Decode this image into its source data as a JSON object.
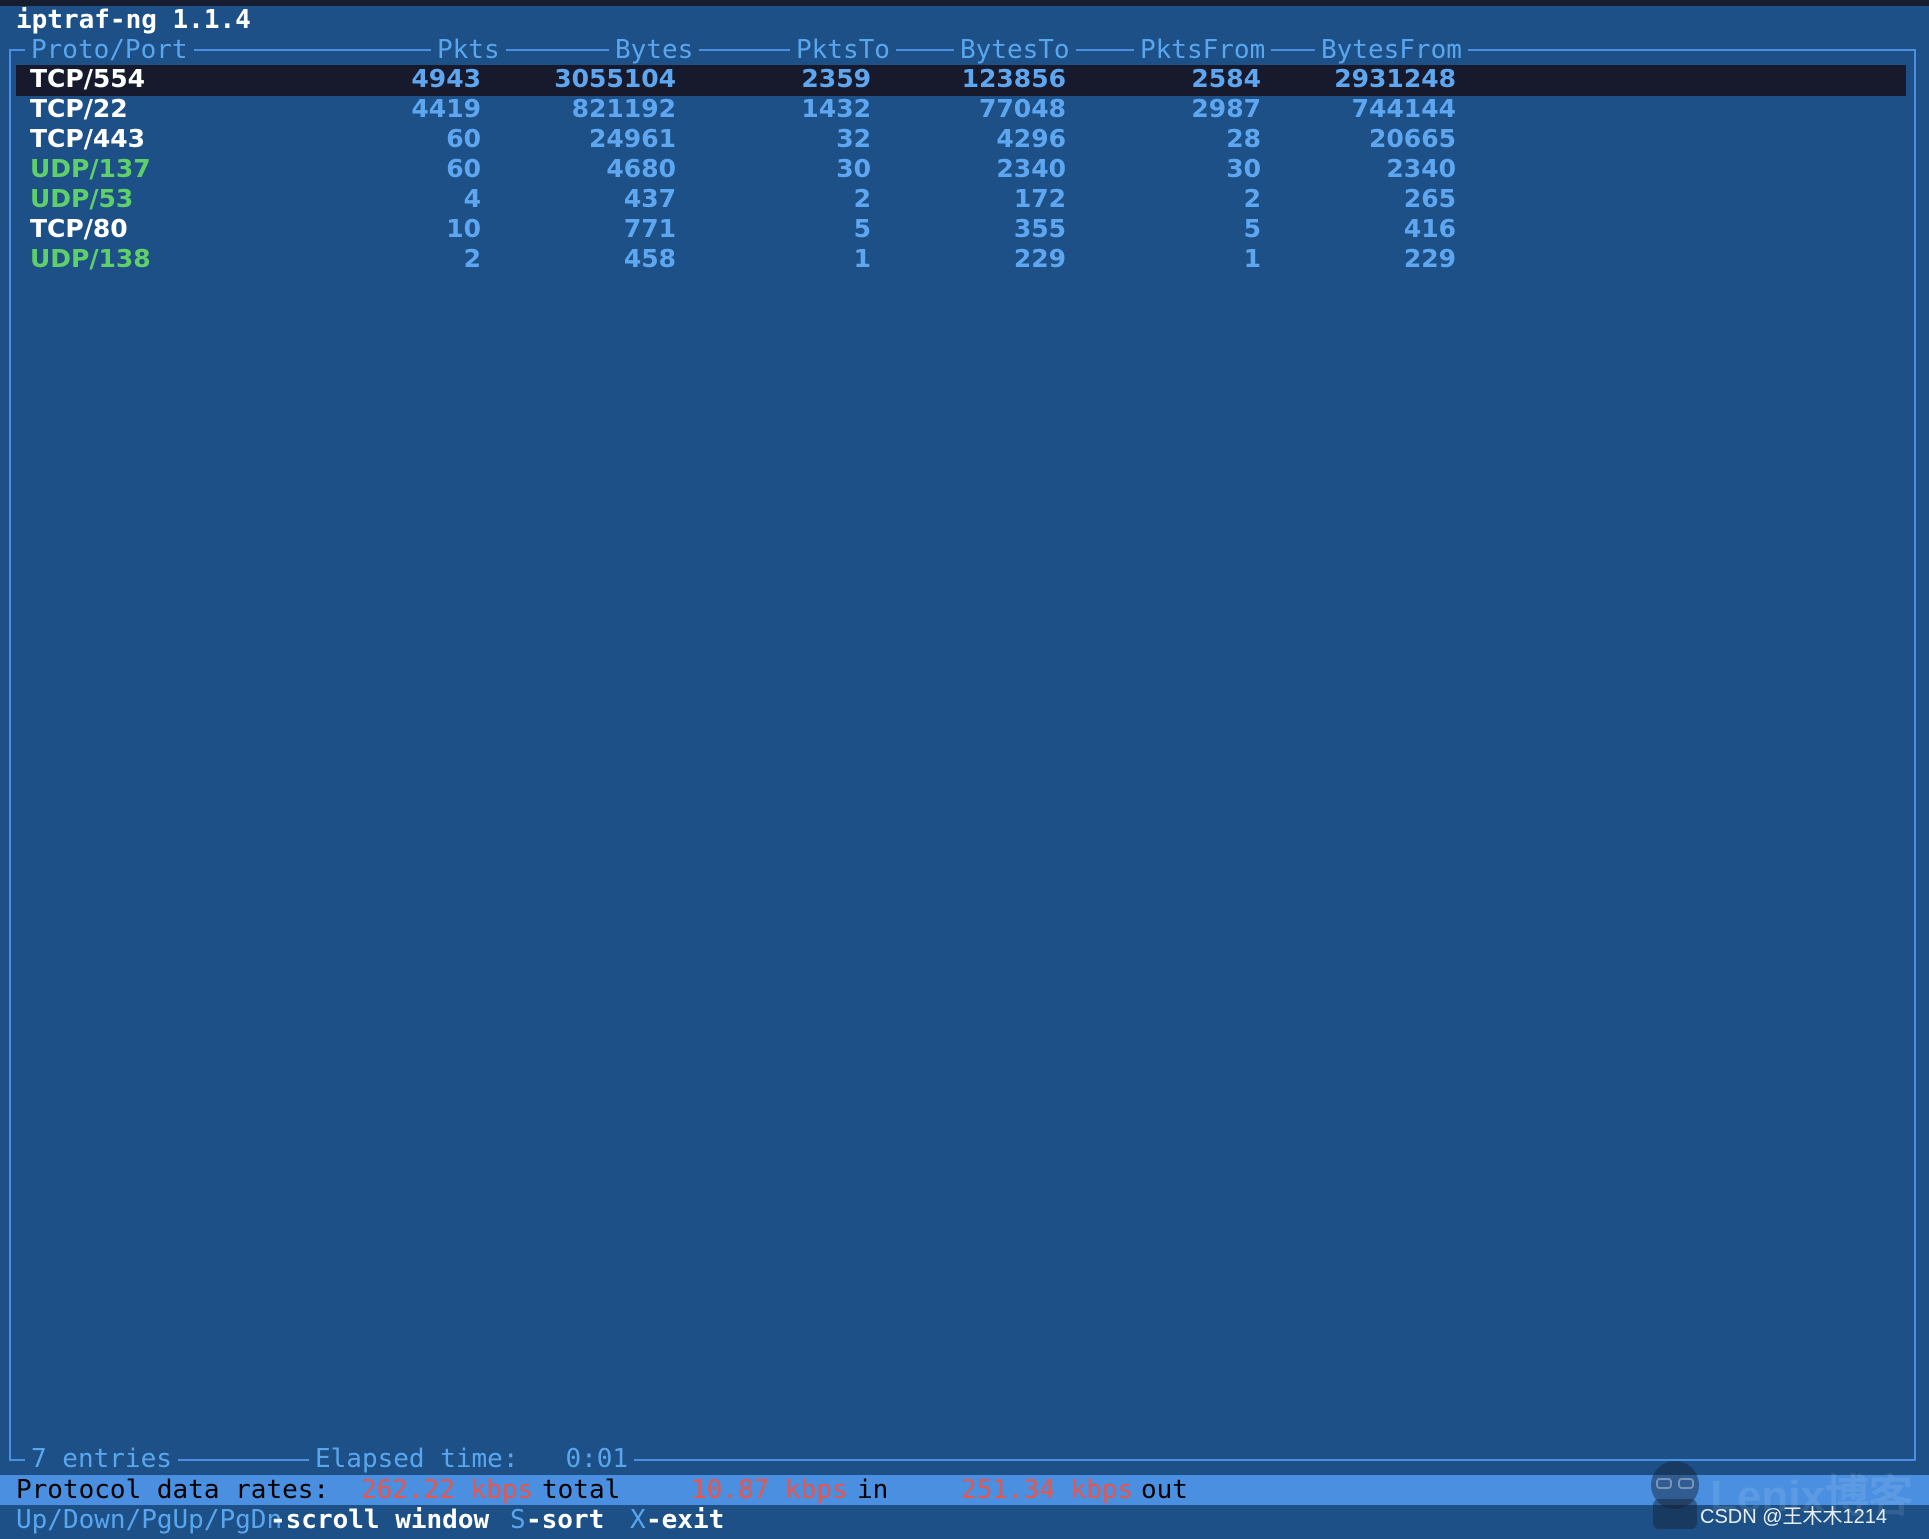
{
  "title": "iptraf-ng 1.1.4",
  "columns": [
    "Proto/Port",
    "Pkts",
    "Bytes",
    "PktsTo",
    "BytesTo",
    "PktsFrom",
    "BytesFrom"
  ],
  "rows": [
    {
      "proto": "TCP/554",
      "type": "tcp",
      "pkts": "4943",
      "bytes": "3055104",
      "pkts_to": "2359",
      "bytes_to": "123856",
      "pkts_from": "2584",
      "bytes_from": "2931248",
      "selected": true
    },
    {
      "proto": "TCP/22",
      "type": "tcp",
      "pkts": "4419",
      "bytes": "821192",
      "pkts_to": "1432",
      "bytes_to": "77048",
      "pkts_from": "2987",
      "bytes_from": "744144",
      "selected": false
    },
    {
      "proto": "TCP/443",
      "type": "tcp",
      "pkts": "60",
      "bytes": "24961",
      "pkts_to": "32",
      "bytes_to": "4296",
      "pkts_from": "28",
      "bytes_from": "20665",
      "selected": false
    },
    {
      "proto": "UDP/137",
      "type": "udp",
      "pkts": "60",
      "bytes": "4680",
      "pkts_to": "30",
      "bytes_to": "2340",
      "pkts_from": "30",
      "bytes_from": "2340",
      "selected": false
    },
    {
      "proto": "UDP/53",
      "type": "udp",
      "pkts": "4",
      "bytes": "437",
      "pkts_to": "2",
      "bytes_to": "172",
      "pkts_from": "2",
      "bytes_from": "265",
      "selected": false
    },
    {
      "proto": "TCP/80",
      "type": "tcp",
      "pkts": "10",
      "bytes": "771",
      "pkts_to": "5",
      "bytes_to": "355",
      "pkts_from": "5",
      "bytes_from": "416",
      "selected": false
    },
    {
      "proto": "UDP/138",
      "type": "udp",
      "pkts": "2",
      "bytes": "458",
      "pkts_to": "1",
      "bytes_to": "229",
      "pkts_from": "1",
      "bytes_from": "229",
      "selected": false
    }
  ],
  "footer": {
    "entries": "7 entries",
    "elapsed_label": "Elapsed time:",
    "elapsed_value": "0:01"
  },
  "rates": {
    "label": "Protocol data rates:",
    "total_value": "262.22 kbps",
    "total_label": "total",
    "in_value": "10.87 kbps",
    "in_label": "in",
    "out_value": "251.34 kbps",
    "out_label": "out"
  },
  "help": [
    {
      "key": "Up/Down/PgUp/PgDn",
      "action": "-scroll window"
    },
    {
      "key": "S",
      "action": "-sort"
    },
    {
      "key": "X",
      "action": "-exit"
    }
  ],
  "watermark": "CSDN @王木木1214",
  "logo_text": "Lenix博客",
  "colors": {
    "background": "#1c5086",
    "border": "#4a8fe0",
    "header_text": "#5aa6ee",
    "number_text": "#5ea7f0",
    "tcp_text": "#ffffff",
    "udp_text": "#5fcf6a",
    "rate_value": "#e8554c",
    "selection": "#161a2c"
  }
}
